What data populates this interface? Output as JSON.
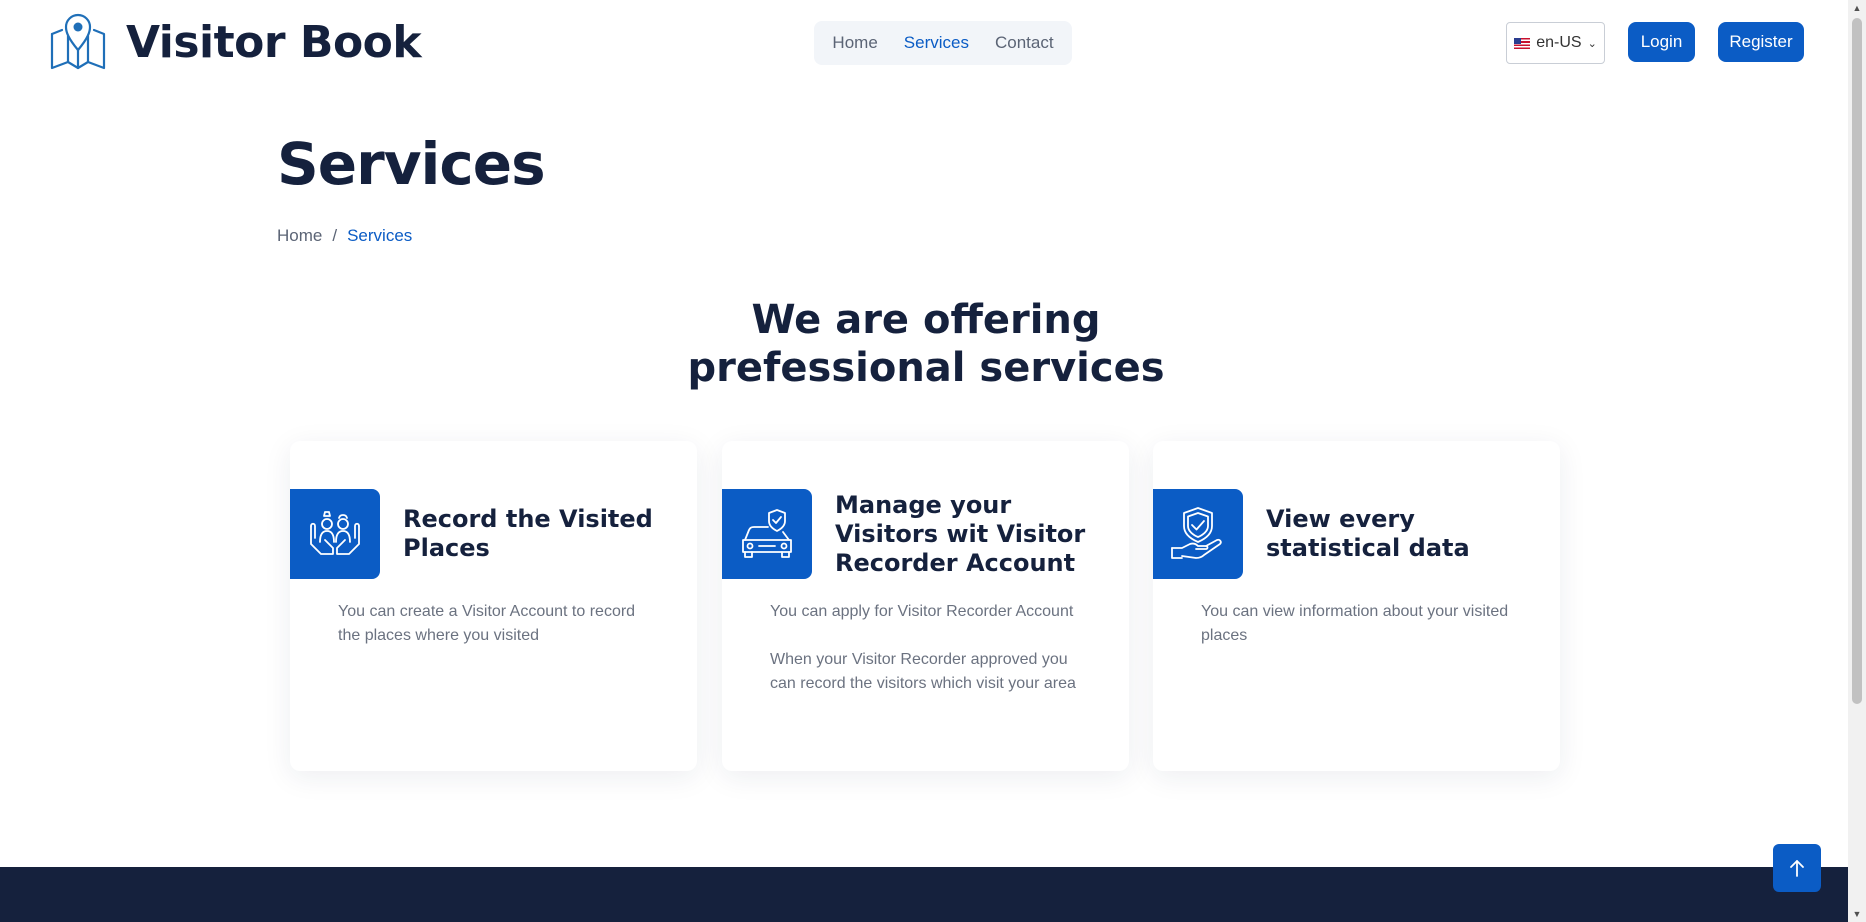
{
  "header": {
    "brand": "Visitor Book",
    "nav": [
      {
        "label": "Home",
        "active": false
      },
      {
        "label": "Services",
        "active": true
      },
      {
        "label": "Contact",
        "active": false
      }
    ],
    "language": "en-US",
    "login_label": "Login",
    "register_label": "Register"
  },
  "page": {
    "title": "Services",
    "breadcrumb": {
      "home": "Home",
      "separator": "/",
      "current": "Services"
    }
  },
  "section": {
    "title_line1": "We are offering",
    "title_line2": "prefessional services"
  },
  "cards": [
    {
      "icon": "hands-people-icon",
      "title": "Record the Visited Places",
      "text": [
        "You can create a Visitor Account to record the places where you visited"
      ]
    },
    {
      "icon": "car-shield-icon",
      "title": "Manage your Visitors wit Visitor Recorder Account",
      "text": [
        "You can apply for Visitor Recorder Account",
        "When your Visitor Recorder approved you can record the visitors which visit your area"
      ]
    },
    {
      "icon": "hand-shield-icon",
      "title": "View every statistical data",
      "text": [
        "You can view information about your visited places"
      ]
    }
  ],
  "colors": {
    "accent": "#0b5cc5",
    "dark": "#15213d",
    "muted": "#6b7280"
  }
}
